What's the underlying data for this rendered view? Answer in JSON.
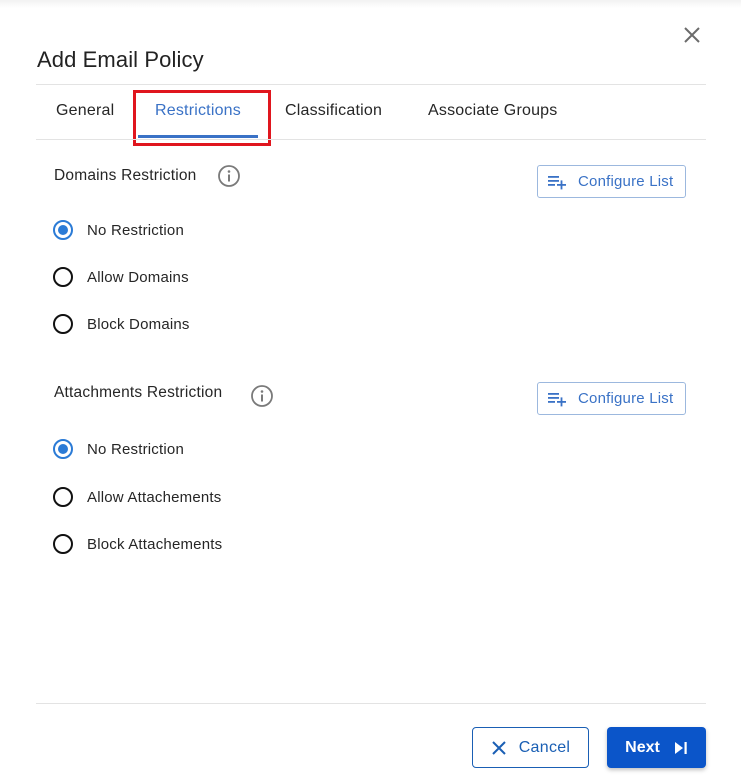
{
  "dialog": {
    "title": "Add Email Policy",
    "close_icon": "close-icon"
  },
  "tabs": [
    {
      "label": "General",
      "active": false
    },
    {
      "label": "Restrictions",
      "active": true
    },
    {
      "label": "Classification",
      "active": false
    },
    {
      "label": "Associate Groups",
      "active": false
    }
  ],
  "sections": {
    "domains": {
      "label": "Domains Restriction",
      "info_icon": "info-icon",
      "configure_label": "Configure List",
      "configure_icon": "playlist-add-icon",
      "options": [
        {
          "label": "No Restriction",
          "checked": true
        },
        {
          "label": "Allow Domains",
          "checked": false
        },
        {
          "label": "Block Domains",
          "checked": false
        }
      ]
    },
    "attachments": {
      "label": "Attachments Restriction",
      "info_icon": "info-icon",
      "configure_label": "Configure List",
      "configure_icon": "playlist-add-icon",
      "options": [
        {
          "label": "No Restriction",
          "checked": true
        },
        {
          "label": "Allow Attachements",
          "checked": false
        },
        {
          "label": "Block Attachements",
          "checked": false
        }
      ]
    }
  },
  "footer": {
    "cancel_label": "Cancel",
    "cancel_icon": "close-icon",
    "next_label": "Next",
    "next_icon": "skip-next-icon"
  },
  "colors": {
    "accent": "#3a72c6",
    "primary_button": "#0b55c9",
    "highlight_box": "#e0161e",
    "radio_checked": "#2b7bd6"
  }
}
